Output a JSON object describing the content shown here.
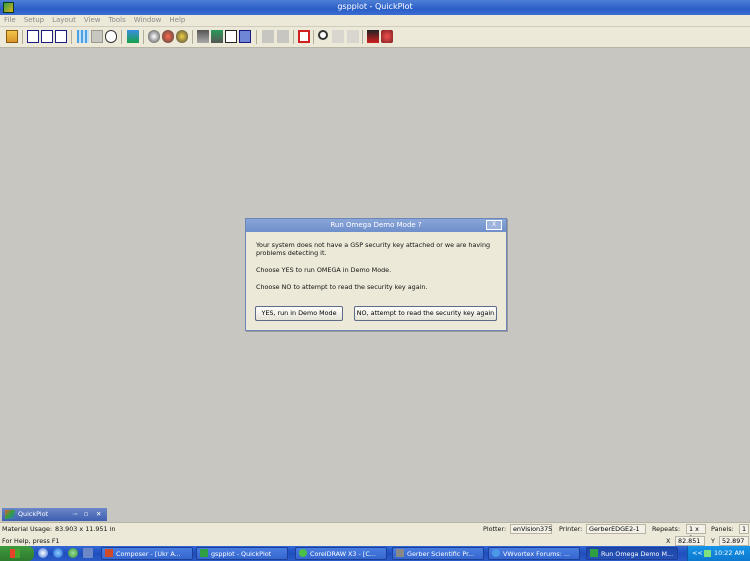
{
  "window": {
    "title": "gspplot - QuickPlot"
  },
  "menu": [
    "File",
    "Setup",
    "Layout",
    "View",
    "Tools",
    "Window",
    "Help"
  ],
  "dialog": {
    "title": "Run Omega Demo Mode ?",
    "close_label": "X",
    "message1": "Your system does not have a GSP security key attached or we are having problems detecting it.",
    "message2": "Choose YES to run OMEGA in Demo Mode.",
    "message3": "Choose NO to attempt to read the security key again.",
    "yes_label": "YES, run in Demo Mode",
    "no_label": "NO, attempt to read the security key again"
  },
  "doc_tab": {
    "label": "QuickPlot"
  },
  "status": {
    "material_label": "Material Usage:",
    "material_value": "83.903 x 11.951 in",
    "help_text": "For Help, press F1",
    "plotter_label": "Plotter:",
    "plotter_value": "enVision375",
    "printer_label": "Printer:",
    "printer_value": "GerberEDGE2-1",
    "repeats_label": "Repeats:",
    "repeats_value": "1 x 1",
    "panels_label": "Panels:",
    "panels_value": "1",
    "x_label": "X",
    "x_value": "82.851",
    "y_label": "Y",
    "y_value": "52.897"
  },
  "taskbar": {
    "tasks": [
      {
        "label": "Composer - [Ukr A...",
        "active": false
      },
      {
        "label": "gspplot - QuickPlot",
        "active": false
      },
      {
        "label": "CorelDRAW X3 - [C...",
        "active": false
      },
      {
        "label": "Gerber Scientific Pr...",
        "active": false
      },
      {
        "label": "VWvortex Forums: ...",
        "active": false
      },
      {
        "label": "Run Omega Demo M...",
        "active": true
      }
    ],
    "overflow": "<<",
    "clock": "10:22 AM"
  },
  "colors": {
    "workspace": "#c8c6c0",
    "titlebar": "#2a5ec7",
    "dialog_title": "#7a98d2",
    "taskbar": "#2458c5",
    "start": "#3a8f3a"
  }
}
